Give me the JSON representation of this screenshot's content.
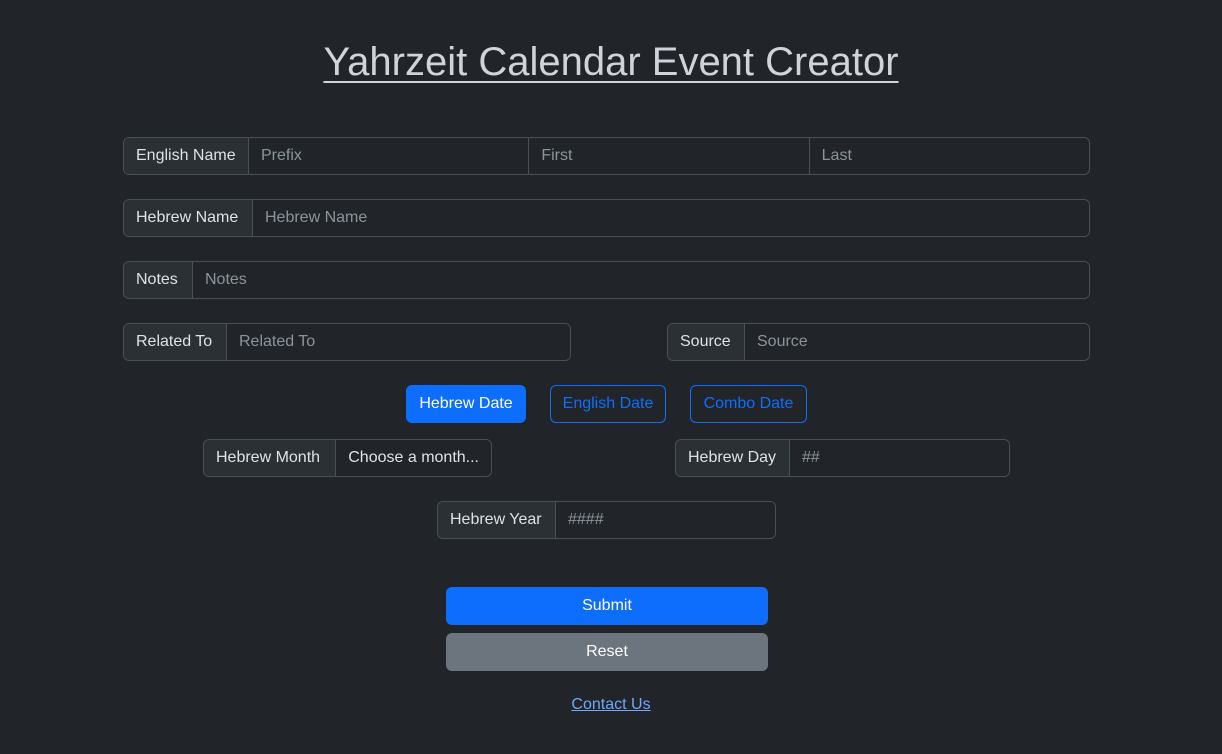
{
  "page": {
    "title": "Yahrzeit Calendar Event Creator"
  },
  "form": {
    "english_name": {
      "label": "English Name",
      "prefix_placeholder": "Prefix",
      "first_placeholder": "First",
      "last_placeholder": "Last"
    },
    "hebrew_name": {
      "label": "Hebrew Name",
      "placeholder": "Hebrew Name"
    },
    "notes": {
      "label": "Notes",
      "placeholder": "Notes"
    },
    "related_to": {
      "label": "Related To",
      "placeholder": "Related To"
    },
    "source": {
      "label": "Source",
      "placeholder": "Source"
    },
    "date_modes": {
      "hebrew": "Hebrew Date",
      "english": "English Date",
      "combo": "Combo Date",
      "selected": "hebrew"
    },
    "hebrew_month": {
      "label": "Hebrew Month",
      "selected": "Choose a month..."
    },
    "hebrew_day": {
      "label": "Hebrew Day",
      "placeholder": "##"
    },
    "hebrew_year": {
      "label": "Hebrew Year",
      "placeholder": "####"
    },
    "submit_label": "Submit",
    "reset_label": "Reset"
  },
  "footer": {
    "contact_label": "Contact Us"
  },
  "colors": {
    "background": "#212529",
    "primary": "#0d6efd",
    "secondary": "#6c757d",
    "link": "#6ea8fe"
  }
}
